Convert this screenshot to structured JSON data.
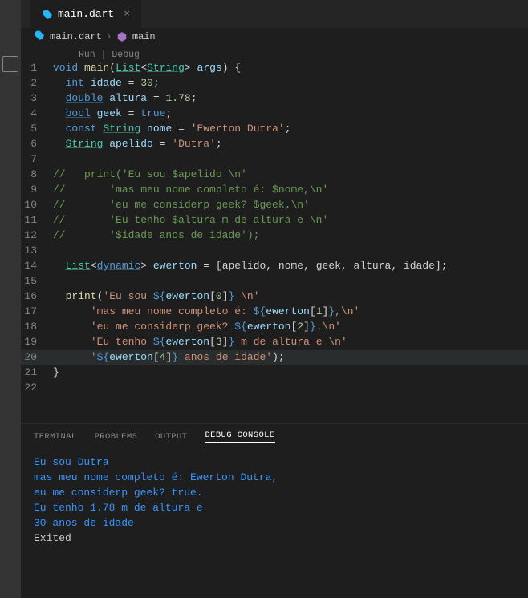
{
  "file": {
    "name": "main.dart",
    "symbol": "main"
  },
  "codelens": "Run | Debug",
  "panel": {
    "tabs": [
      "TERMINAL",
      "PROBLEMS",
      "OUTPUT",
      "DEBUG CONSOLE"
    ],
    "activeIndex": 3,
    "output": [
      "Eu sou Dutra ",
      "mas meu nome completo é: Ewerton Dutra,",
      "eu me considerp geek? true.",
      "Eu tenho 1.78 m de altura e ",
      "30 anos de idade"
    ],
    "exited": "Exited"
  },
  "code": {
    "line1": {
      "t0": "void",
      "t1": " ",
      "t2": "main",
      "t3": "(",
      "t4": "List",
      "t5": "<",
      "t6": "String",
      "t7": "> ",
      "t8": "args",
      "t9": ") {"
    },
    "line2": {
      "pad": "  ",
      "t0": "int",
      "t1": " idade ",
      "t2": "=",
      "t3": " ",
      "t4": "30",
      "t5": ";"
    },
    "line3": {
      "pad": "  ",
      "t0": "double",
      "t1": " altura ",
      "t2": "=",
      "t3": " ",
      "t4": "1.78",
      "t5": ";"
    },
    "line4": {
      "pad": "  ",
      "t0": "bool",
      "t1": " geek ",
      "t2": "=",
      "t3": " ",
      "t4": "true",
      "t5": ";"
    },
    "line5": {
      "pad": "  ",
      "t0": "const",
      "t1": " ",
      "t2": "String",
      "t3": " nome ",
      "t4": "=",
      "t5": " ",
      "t6": "'Ewerton Dutra'",
      "t7": ";"
    },
    "line6": {
      "pad": "  ",
      "t0": "String",
      "t1": " apelido ",
      "t2": "=",
      "t3": " ",
      "t4": "'Dutra'",
      "t5": ";"
    },
    "line8": "//   print('Eu sou $apelido \\n'",
    "line9": "//       'mas meu nome completo é: $nome,\\n'",
    "line10": "//       'eu me considerp geek? $geek.\\n'",
    "line11": "//       'Eu tenho $altura m de altura e \\n'",
    "line12": "//       '$idade anos de idade');",
    "line14": {
      "pad": "  ",
      "t0": "List",
      "t1": "<",
      "t2": "dynamic",
      "t3": ">",
      "t4": " ewerton ",
      "t5": "=",
      "t6": " [apelido, nome, geek, altura, idade];"
    },
    "line16": {
      "pad": "  ",
      "t0": "print",
      "t1": "(",
      "t2": "'Eu sou ",
      "t3": "${",
      "t4": "ewerton",
      "t5": "[",
      "t6": "0",
      "t7": "]",
      "t8": "}",
      "t9": " \\n'"
    },
    "line17": {
      "pad": "      ",
      "t0": "'mas meu nome completo é: ",
      "t1": "${",
      "t2": "ewerton",
      "t3": "[",
      "t4": "1",
      "t5": "]",
      "t6": "}",
      "t7": ",\\n'"
    },
    "line18": {
      "pad": "      ",
      "t0": "'eu me considerp geek? ",
      "t1": "${",
      "t2": "ewerton",
      "t3": "[",
      "t4": "2",
      "t5": "]",
      "t6": "}",
      "t7": ".\\n'"
    },
    "line19": {
      "pad": "      ",
      "t0": "'Eu tenho ",
      "t1": "${",
      "t2": "ewerton",
      "t3": "[",
      "t4": "3",
      "t5": "]",
      "t6": "}",
      "t7": " m de altura e \\n'"
    },
    "line20": {
      "pad": "      ",
      "t0": "'",
      "t1": "${",
      "t2": "ewerton",
      "t3": "[",
      "t4": "4",
      "t5": "]",
      "t6": "}",
      "t7": " anos de idade'",
      "t8": ");"
    },
    "line21": "}"
  },
  "lineNumbers": [
    "1",
    "2",
    "3",
    "4",
    "5",
    "6",
    "7",
    "8",
    "9",
    "10",
    "11",
    "12",
    "13",
    "14",
    "15",
    "16",
    "17",
    "18",
    "19",
    "20",
    "21",
    "22"
  ]
}
